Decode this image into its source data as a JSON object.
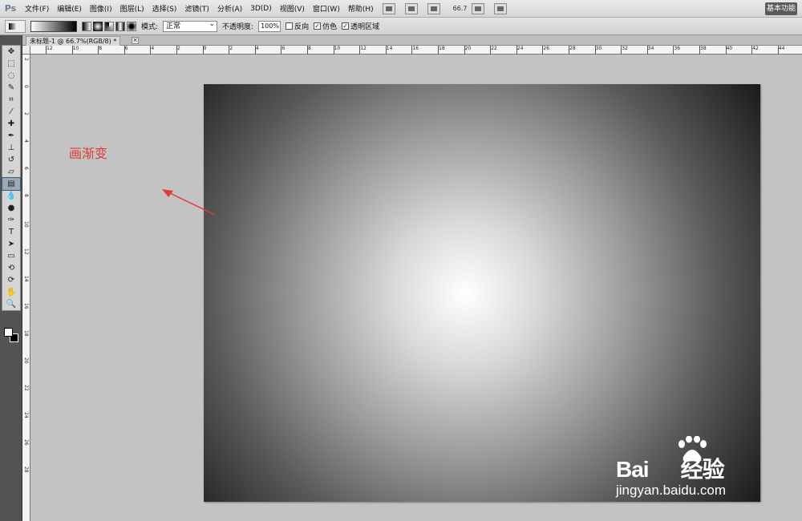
{
  "app": {
    "logo": "Ps",
    "workspace": "基本功能",
    "zoom": "66.7"
  },
  "menu": [
    "文件(F)",
    "编辑(E)",
    "图像(I)",
    "图层(L)",
    "选择(S)",
    "滤镜(T)",
    "分析(A)",
    "3D(D)",
    "视图(V)",
    "窗口(W)",
    "帮助(H)"
  ],
  "menubar_buttons": [
    "Br",
    "Mb"
  ],
  "options": {
    "mode_label": "模式:",
    "mode_value": "正常",
    "opacity_label": "不透明度:",
    "opacity_value": "100%",
    "reverse": {
      "label": "反向",
      "checked": false
    },
    "dither": {
      "label": "仿色",
      "checked": true
    },
    "transparency": {
      "label": "透明区域",
      "checked": true
    },
    "active_gradient_type": "radial"
  },
  "document": {
    "tab_title": "未标题-1 @ 66.7%(RGB/8) *",
    "close": "×"
  },
  "rulers": {
    "top": [
      "12",
      "10",
      "8",
      "6",
      "4",
      "2",
      "0",
      "2",
      "4",
      "6",
      "8",
      "10",
      "12",
      "14",
      "16",
      "18",
      "20",
      "22",
      "24",
      "26",
      "28",
      "30",
      "32",
      "34",
      "36",
      "38",
      "40",
      "42",
      "44"
    ],
    "left": [
      "2",
      "0",
      "2",
      "4",
      "6",
      "8",
      "10",
      "12",
      "14",
      "16",
      "18",
      "20",
      "22",
      "24",
      "26",
      "28"
    ]
  },
  "tools": [
    "move",
    "marquee",
    "lasso",
    "quick-select",
    "crop",
    "eyedropper",
    "healing",
    "brush",
    "clone-stamp",
    "history-brush",
    "eraser",
    "gradient",
    "blur",
    "dodge",
    "pen",
    "type",
    "path-select",
    "shape",
    "3d-rotate",
    "3d-orbit",
    "hand",
    "zoom"
  ],
  "active_tool": "gradient",
  "annotation": "画渐变",
  "annotation_color": "#e03b3b",
  "watermark": {
    "brand": "Bai",
    "brand2": "经验",
    "url": "jingyan.baidu.com"
  }
}
